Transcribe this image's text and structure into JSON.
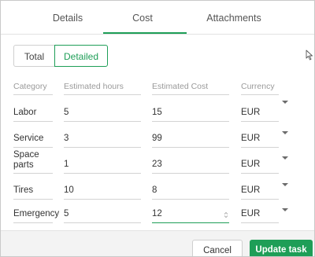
{
  "tabs": [
    {
      "label": "Details",
      "active": false
    },
    {
      "label": "Cost",
      "active": true
    },
    {
      "label": "Attachments",
      "active": false
    }
  ],
  "toggle": {
    "total": "Total",
    "detailed": "Detailed",
    "selected": "Detailed"
  },
  "table": {
    "headers": {
      "category": "Category",
      "hours": "Estimated hours",
      "cost": "Estimated Cost",
      "currency": "Currency"
    },
    "rows": [
      {
        "category": "Labor",
        "hours": "5",
        "cost": "15",
        "currency": "EUR"
      },
      {
        "category": "Service",
        "hours": "3",
        "cost": "99",
        "currency": "EUR"
      },
      {
        "category_line1": "Space",
        "category_line2": "parts",
        "hours": "1",
        "cost": "23",
        "currency": "EUR"
      },
      {
        "category": "Tires",
        "hours": "10",
        "cost": "8",
        "currency": "EUR"
      },
      {
        "category": "Emergency",
        "hours": "5",
        "cost": "12",
        "currency": "EUR",
        "focused_field": "cost"
      }
    ]
  },
  "footer": {
    "cancel": "Cancel",
    "update": "Update task"
  },
  "colors": {
    "accent": "#1e9e57"
  }
}
